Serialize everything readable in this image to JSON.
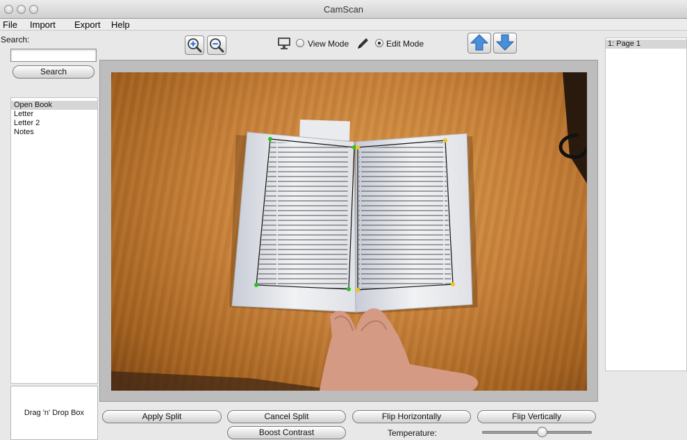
{
  "window": {
    "title": "CamScan"
  },
  "menu": [
    "File",
    "Import",
    "Export",
    "Help"
  ],
  "search": {
    "label": "Search:",
    "value": "",
    "button": "Search"
  },
  "documents": [
    {
      "label": "Open Book",
      "selected": true
    },
    {
      "label": "Letter",
      "selected": false
    },
    {
      "label": "Letter 2",
      "selected": false
    },
    {
      "label": "Notes",
      "selected": false
    }
  ],
  "toolbar": {
    "zoom_in_icon": "zoom-in-icon",
    "zoom_out_icon": "zoom-out-icon",
    "view_mode": "View Mode",
    "edit_mode": "Edit Mode",
    "selected_mode": "edit",
    "up_icon": "arrow-up-icon",
    "down_icon": "arrow-down-icon"
  },
  "pages": [
    {
      "label": "1: Page 1",
      "selected": true
    }
  ],
  "drag_box": {
    "label": "Drag 'n' Drop Box"
  },
  "actions": {
    "apply_split": "Apply Split",
    "cancel_split": "Cancel Split",
    "flip_horizontally": "Flip Horizontally",
    "flip_vertically": "Flip Vertically",
    "boost_contrast": "Boost Contrast"
  },
  "temperature": {
    "label": "Temperature:",
    "value": 0.5
  },
  "colors": {
    "accent_blue": "#4a8fd9",
    "handle_green": "#22c51f",
    "handle_yellow": "#f0c419",
    "wood": "#c6803a"
  }
}
